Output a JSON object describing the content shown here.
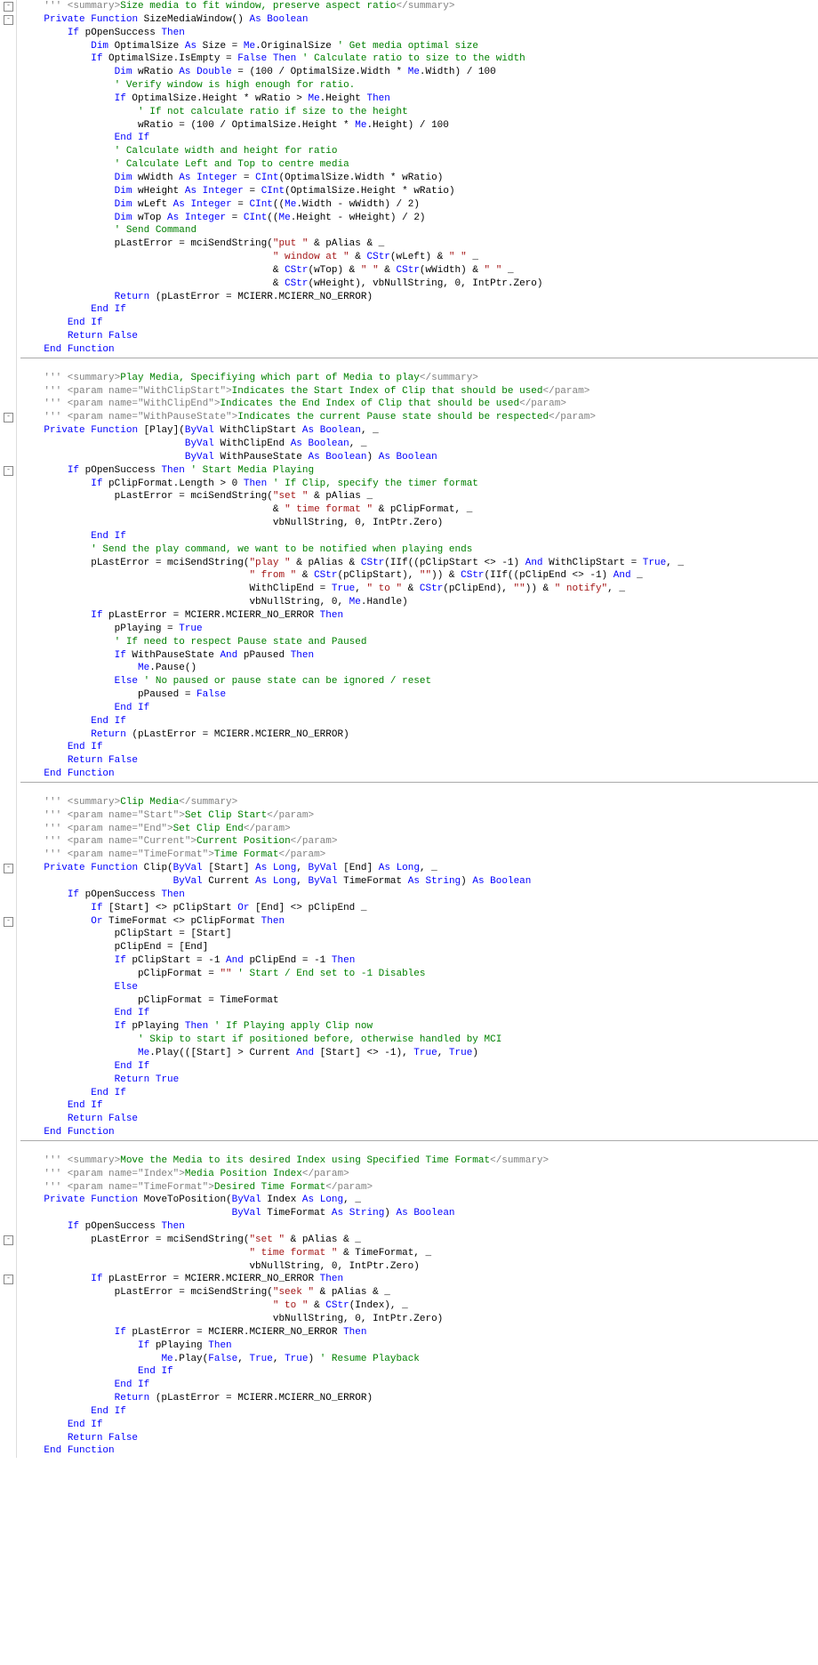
{
  "folds": [
    {
      "row": 0,
      "sym": "-"
    },
    {
      "row": 1,
      "sym": "-"
    },
    {
      "row": 31,
      "sym": "-"
    },
    {
      "row": 35,
      "sym": "-"
    },
    {
      "row": 65,
      "sym": "-"
    },
    {
      "row": 69,
      "sym": "-"
    },
    {
      "row": 93,
      "sym": "-"
    },
    {
      "row": 96,
      "sym": "-"
    }
  ],
  "lines": [
    {
      "i": 0,
      "t": "    <span class='gry'>''' &lt;summary&gt;</span><span class='cmt'>Size media to fit window, preserve aspect ratio</span><span class='gry'>&lt;/summary&gt;</span>"
    },
    {
      "i": 0,
      "t": "    <span class='kw'>Private</span> <span class='kw'>Function</span> SizeMediaWindow() <span class='kw'>As</span> <span class='kw'>Boolean</span>"
    },
    {
      "i": 0,
      "t": "        <span class='kw'>If</span> pOpenSuccess <span class='kw'>Then</span>"
    },
    {
      "i": 0,
      "t": "            <span class='kw'>Dim</span> OptimalSize <span class='kw'>As</span> Size = <span class='kw'>Me</span>.OriginalSize <span class='cmt'>' Get media optimal size</span>"
    },
    {
      "i": 0,
      "t": "            <span class='kw'>If</span> OptimalSize.IsEmpty = <span class='kw'>False</span> <span class='kw'>Then</span> <span class='cmt'>' Calculate ratio to size to the width</span>"
    },
    {
      "i": 0,
      "t": "                <span class='kw'>Dim</span> wRatio <span class='kw'>As</span> <span class='kw'>Double</span> = (100 / OptimalSize.Width * <span class='kw'>Me</span>.Width) / 100"
    },
    {
      "i": 0,
      "t": "                <span class='cmt'>' Verify window is high enough for ratio.</span>"
    },
    {
      "i": 0,
      "t": "                <span class='kw'>If</span> OptimalSize.Height * wRatio &gt; <span class='kw'>Me</span>.Height <span class='kw'>Then</span>"
    },
    {
      "i": 0,
      "t": "                    <span class='cmt'>' If not calculate ratio if size to the height</span>"
    },
    {
      "i": 0,
      "t": "                    wRatio = (100 / OptimalSize.Height * <span class='kw'>Me</span>.Height) / 100"
    },
    {
      "i": 0,
      "t": "                <span class='kw'>End</span> <span class='kw'>If</span>"
    },
    {
      "i": 0,
      "t": "                <span class='cmt'>' Calculate width and height for ratio</span>"
    },
    {
      "i": 0,
      "t": "                <span class='cmt'>' Calculate Left and Top to centre media</span>"
    },
    {
      "i": 0,
      "t": "                <span class='kw'>Dim</span> wWidth <span class='kw'>As</span> <span class='kw'>Integer</span> = <span class='kw'>CInt</span>(OptimalSize.Width * wRatio)"
    },
    {
      "i": 0,
      "t": "                <span class='kw'>Dim</span> wHeight <span class='kw'>As</span> <span class='kw'>Integer</span> = <span class='kw'>CInt</span>(OptimalSize.Height * wRatio)"
    },
    {
      "i": 0,
      "t": "                <span class='kw'>Dim</span> wLeft <span class='kw'>As</span> <span class='kw'>Integer</span> = <span class='kw'>CInt</span>((<span class='kw'>Me</span>.Width - wWidth) / 2)"
    },
    {
      "i": 0,
      "t": "                <span class='kw'>Dim</span> wTop <span class='kw'>As</span> <span class='kw'>Integer</span> = <span class='kw'>CInt</span>((<span class='kw'>Me</span>.Height - wHeight) / 2)"
    },
    {
      "i": 0,
      "t": "                <span class='cmt'>' Send Command</span>"
    },
    {
      "i": 0,
      "t": "                pLastError = mciSendString(<span class='str'>\"put \"</span> &amp; pAlias &amp; _"
    },
    {
      "i": 0,
      "t": "                                           <span class='str'>\" window at \"</span> &amp; <span class='kw'>CStr</span>(wLeft) &amp; <span class='str'>\" \"</span> _"
    },
    {
      "i": 0,
      "t": "                                           &amp; <span class='kw'>CStr</span>(wTop) &amp; <span class='str'>\" \"</span> &amp; <span class='kw'>CStr</span>(wWidth) &amp; <span class='str'>\" \"</span> _"
    },
    {
      "i": 0,
      "t": "                                           &amp; <span class='kw'>CStr</span>(wHeight), vbNullString, 0, IntPtr.Zero)"
    },
    {
      "i": 0,
      "t": "                <span class='kw'>Return</span> (pLastError = MCIERR.MCIERR_NO_ERROR)"
    },
    {
      "i": 0,
      "t": "            <span class='kw'>End</span> <span class='kw'>If</span>"
    },
    {
      "i": 0,
      "t": "        <span class='kw'>End</span> <span class='kw'>If</span>"
    },
    {
      "i": 0,
      "t": "        <span class='kw'>Return</span> <span class='kw'>False</span>"
    },
    {
      "i": 0,
      "t": "    <span class='kw'>End</span> <span class='kw'>Function</span>"
    },
    {
      "sep": true
    },
    {
      "i": 0,
      "t": ""
    },
    {
      "i": 0,
      "t": "    <span class='gry'>''' &lt;summary&gt;</span><span class='cmt'>Play Media, Specifiying which part of Media to play</span><span class='gry'>&lt;/summary&gt;</span>"
    },
    {
      "i": 0,
      "t": "    <span class='gry'>''' &lt;param name=\"WithClipStart\"&gt;</span><span class='cmt'>Indicates the Start Index of Clip that should be used</span><span class='gry'>&lt;/param&gt;</span>"
    },
    {
      "i": 0,
      "t": "    <span class='gry'>''' &lt;param name=\"WithClipEnd\"&gt;</span><span class='cmt'>Indicates the End Index of Clip that should be used</span><span class='gry'>&lt;/param&gt;</span>"
    },
    {
      "i": 0,
      "t": "    <span class='gry'>''' &lt;param name=\"WithPauseState\"&gt;</span><span class='cmt'>Indicates the current Pause state should be respected</span><span class='gry'>&lt;/param&gt;</span>"
    },
    {
      "i": 0,
      "t": "    <span class='kw'>Private</span> <span class='kw'>Function</span> [Play](<span class='kw'>ByVal</span> WithClipStart <span class='kw'>As</span> <span class='kw'>Boolean</span>, _"
    },
    {
      "i": 0,
      "t": "                            <span class='kw'>ByVal</span> WithClipEnd <span class='kw'>As</span> <span class='kw'>Boolean</span>, _"
    },
    {
      "i": 0,
      "t": "                            <span class='kw'>ByVal</span> WithPauseState <span class='kw'>As</span> <span class='kw'>Boolean</span>) <span class='kw'>As</span> <span class='kw'>Boolean</span>"
    },
    {
      "i": 0,
      "t": "        <span class='kw'>If</span> pOpenSuccess <span class='kw'>Then</span> <span class='cmt'>' Start Media Playing</span>"
    },
    {
      "i": 0,
      "t": "            <span class='kw'>If</span> pClipFormat.Length &gt; 0 <span class='kw'>Then</span> <span class='cmt'>' If Clip, specify the timer format</span>"
    },
    {
      "i": 0,
      "t": "                pLastError = mciSendString(<span class='str'>\"set \"</span> &amp; pAlias _"
    },
    {
      "i": 0,
      "t": "                                           &amp; <span class='str'>\" time format \"</span> &amp; pClipFormat, _"
    },
    {
      "i": 0,
      "t": "                                           vbNullString, 0, IntPtr.Zero)"
    },
    {
      "i": 0,
      "t": "            <span class='kw'>End</span> <span class='kw'>If</span>"
    },
    {
      "i": 0,
      "t": "            <span class='cmt'>' Send the play command, we want to be notified when playing ends</span>"
    },
    {
      "i": 0,
      "t": "            pLastError = mciSendString(<span class='str'>\"play \"</span> &amp; pAlias &amp; <span class='kw'>CStr</span>(IIf((pClipStart &lt;&gt; -1) <span class='kw'>And</span> WithClipStart = <span class='kw'>True</span>, _"
    },
    {
      "i": 0,
      "t": "                                       <span class='str'>\" from \"</span> &amp; <span class='kw'>CStr</span>(pClipStart), <span class='str'>\"\"</span>)) &amp; <span class='kw'>CStr</span>(IIf((pClipEnd &lt;&gt; -1) <span class='kw'>And</span> _"
    },
    {
      "i": 0,
      "t": "                                       WithClipEnd = <span class='kw'>True</span>, <span class='str'>\" to \"</span> &amp; <span class='kw'>CStr</span>(pClipEnd), <span class='str'>\"\"</span>)) &amp; <span class='str'>\" notify\"</span>, _"
    },
    {
      "i": 0,
      "t": "                                       vbNullString, 0, <span class='kw'>Me</span>.Handle)"
    },
    {
      "i": 0,
      "t": "            <span class='kw'>If</span> pLastError = MCIERR.MCIERR_NO_ERROR <span class='kw'>Then</span>"
    },
    {
      "i": 0,
      "t": "                pPlaying = <span class='kw'>True</span>"
    },
    {
      "i": 0,
      "t": "                <span class='cmt'>' If need to respect Pause state and Paused</span>"
    },
    {
      "i": 0,
      "t": "                <span class='kw'>If</span> WithPauseState <span class='kw'>And</span> pPaused <span class='kw'>Then</span>"
    },
    {
      "i": 0,
      "t": "                    <span class='kw'>Me</span>.Pause()"
    },
    {
      "i": 0,
      "t": "                <span class='kw'>Else</span> <span class='cmt'>' No paused or pause state can be ignored / reset</span>"
    },
    {
      "i": 0,
      "t": "                    pPaused = <span class='kw'>False</span>"
    },
    {
      "i": 0,
      "t": "                <span class='kw'>End</span> <span class='kw'>If</span>"
    },
    {
      "i": 0,
      "t": "            <span class='kw'>End</span> <span class='kw'>If</span>"
    },
    {
      "i": 0,
      "t": "            <span class='kw'>Return</span> (pLastError = MCIERR.MCIERR_NO_ERROR)"
    },
    {
      "i": 0,
      "t": "        <span class='kw'>End</span> <span class='kw'>If</span>"
    },
    {
      "i": 0,
      "t": "        <span class='kw'>Return</span> <span class='kw'>False</span>"
    },
    {
      "i": 0,
      "t": "    <span class='kw'>End</span> <span class='kw'>Function</span>"
    },
    {
      "sep": true
    },
    {
      "i": 0,
      "t": ""
    },
    {
      "i": 0,
      "t": "    <span class='gry'>''' &lt;summary&gt;</span><span class='cmt'>Clip Media</span><span class='gry'>&lt;/summary&gt;</span>"
    },
    {
      "i": 0,
      "t": "    <span class='gry'>''' &lt;param name=\"Start\"&gt;</span><span class='cmt'>Set Clip Start</span><span class='gry'>&lt;/param&gt;</span>"
    },
    {
      "i": 0,
      "t": "    <span class='gry'>''' &lt;param name=\"End\"&gt;</span><span class='cmt'>Set Clip End</span><span class='gry'>&lt;/param&gt;</span>"
    },
    {
      "i": 0,
      "t": "    <span class='gry'>''' &lt;param name=\"Current\"&gt;</span><span class='cmt'>Current Position</span><span class='gry'>&lt;/param&gt;</span>"
    },
    {
      "i": 0,
      "t": "    <span class='gry'>''' &lt;param name=\"TimeFormat\"&gt;</span><span class='cmt'>Time Format</span><span class='gry'>&lt;/param&gt;</span>"
    },
    {
      "i": 0,
      "t": "    <span class='kw'>Private</span> <span class='kw'>Function</span> Clip(<span class='kw'>ByVal</span> [Start] <span class='kw'>As</span> <span class='kw'>Long</span>, <span class='kw'>ByVal</span> [End] <span class='kw'>As</span> <span class='kw'>Long</span>, _"
    },
    {
      "i": 0,
      "t": "                          <span class='kw'>ByVal</span> Current <span class='kw'>As</span> <span class='kw'>Long</span>, <span class='kw'>ByVal</span> TimeFormat <span class='kw'>As</span> <span class='kw'>String</span>) <span class='kw'>As</span> <span class='kw'>Boolean</span>"
    },
    {
      "i": 0,
      "t": "        <span class='kw'>If</span> pOpenSuccess <span class='kw'>Then</span>"
    },
    {
      "i": 0,
      "t": "            <span class='kw'>If</span> [Start] &lt;&gt; pClipStart <span class='kw'>Or</span> [End] &lt;&gt; pClipEnd _"
    },
    {
      "i": 0,
      "t": "            <span class='kw'>Or</span> TimeFormat &lt;&gt; pClipFormat <span class='kw'>Then</span>"
    },
    {
      "i": 0,
      "t": "                pClipStart = [Start]"
    },
    {
      "i": 0,
      "t": "                pClipEnd = [End]"
    },
    {
      "i": 0,
      "t": "                <span class='kw'>If</span> pClipStart = -1 <span class='kw'>And</span> pClipEnd = -1 <span class='kw'>Then</span>"
    },
    {
      "i": 0,
      "t": "                    pClipFormat = <span class='str'>\"\"</span> <span class='cmt'>' Start / End set to -1 Disables</span>"
    },
    {
      "i": 0,
      "t": "                <span class='kw'>Else</span>"
    },
    {
      "i": 0,
      "t": "                    pClipFormat = TimeFormat"
    },
    {
      "i": 0,
      "t": "                <span class='kw'>End</span> <span class='kw'>If</span>"
    },
    {
      "i": 0,
      "t": "                <span class='kw'>If</span> pPlaying <span class='kw'>Then</span> <span class='cmt'>' If Playing apply Clip now</span>"
    },
    {
      "i": 0,
      "t": "                    <span class='cmt'>' Skip to start if positioned before, otherwise handled by MCI</span>"
    },
    {
      "i": 0,
      "t": "                    <span class='kw'>Me</span>.Play(([Start] &gt; Current <span class='kw'>And</span> [Start] &lt;&gt; -1), <span class='kw'>True</span>, <span class='kw'>True</span>)"
    },
    {
      "i": 0,
      "t": "                <span class='kw'>End</span> <span class='kw'>If</span>"
    },
    {
      "i": 0,
      "t": "                <span class='kw'>Return</span> <span class='kw'>True</span>"
    },
    {
      "i": 0,
      "t": "            <span class='kw'>End</span> <span class='kw'>If</span>"
    },
    {
      "i": 0,
      "t": "        <span class='kw'>End</span> <span class='kw'>If</span>"
    },
    {
      "i": 0,
      "t": "        <span class='kw'>Return</span> <span class='kw'>False</span>"
    },
    {
      "i": 0,
      "t": "    <span class='kw'>End</span> <span class='kw'>Function</span>"
    },
    {
      "sep": true
    },
    {
      "i": 0,
      "t": ""
    },
    {
      "i": 0,
      "t": "    <span class='gry'>''' &lt;summary&gt;</span><span class='cmt'>Move the Media to its desired Index using Specified Time Format</span><span class='gry'>&lt;/summary&gt;</span>"
    },
    {
      "i": 0,
      "t": "    <span class='gry'>''' &lt;param name=\"Index\"&gt;</span><span class='cmt'>Media Position Index</span><span class='gry'>&lt;/param&gt;</span>"
    },
    {
      "i": 0,
      "t": "    <span class='gry'>''' &lt;param name=\"TimeFormat\"&gt;</span><span class='cmt'>Desired Time Format</span><span class='gry'>&lt;/param&gt;</span>"
    },
    {
      "i": 0,
      "t": "    <span class='kw'>Private</span> <span class='kw'>Function</span> MoveToPosition(<span class='kw'>ByVal</span> Index <span class='kw'>As</span> <span class='kw'>Long</span>, _"
    },
    {
      "i": 0,
      "t": "                                    <span class='kw'>ByVal</span> TimeFormat <span class='kw'>As</span> <span class='kw'>String</span>) <span class='kw'>As</span> <span class='kw'>Boolean</span>"
    },
    {
      "i": 0,
      "t": "        <span class='kw'>If</span> pOpenSuccess <span class='kw'>Then</span>"
    },
    {
      "i": 0,
      "t": "            pLastError = mciSendString(<span class='str'>\"set \"</span> &amp; pAlias &amp; _"
    },
    {
      "i": 0,
      "t": "                                       <span class='str'>\" time format \"</span> &amp; TimeFormat, _"
    },
    {
      "i": 0,
      "t": "                                       vbNullString, 0, IntPtr.Zero)"
    },
    {
      "i": 0,
      "t": "            <span class='kw'>If</span> pLastError = MCIERR.MCIERR_NO_ERROR <span class='kw'>Then</span>"
    },
    {
      "i": 0,
      "t": "                pLastError = mciSendString(<span class='str'>\"seek \"</span> &amp; pAlias &amp; _"
    },
    {
      "i": 0,
      "t": "                                           <span class='str'>\" to \"</span> &amp; <span class='kw'>CStr</span>(Index), _"
    },
    {
      "i": 0,
      "t": "                                           vbNullString, 0, IntPtr.Zero)"
    },
    {
      "i": 0,
      "t": "                <span class='kw'>If</span> pLastError = MCIERR.MCIERR_NO_ERROR <span class='kw'>Then</span>"
    },
    {
      "i": 0,
      "t": "                    <span class='kw'>If</span> pPlaying <span class='kw'>Then</span>"
    },
    {
      "i": 0,
      "t": "                        <span class='kw'>Me</span>.Play(<span class='kw'>False</span>, <span class='kw'>True</span>, <span class='kw'>True</span>) <span class='cmt'>' Resume Playback</span>"
    },
    {
      "i": 0,
      "t": "                    <span class='kw'>End</span> <span class='kw'>If</span>"
    },
    {
      "i": 0,
      "t": "                <span class='kw'>End</span> <span class='kw'>If</span>"
    },
    {
      "i": 0,
      "t": "                <span class='kw'>Return</span> (pLastError = MCIERR.MCIERR_NO_ERROR)"
    },
    {
      "i": 0,
      "t": "            <span class='kw'>End</span> <span class='kw'>If</span>"
    },
    {
      "i": 0,
      "t": "        <span class='kw'>End</span> <span class='kw'>If</span>"
    },
    {
      "i": 0,
      "t": "        <span class='kw'>Return</span> <span class='kw'>False</span>"
    },
    {
      "i": 0,
      "t": "    <span class='kw'>End</span> <span class='kw'>Function</span>"
    }
  ]
}
